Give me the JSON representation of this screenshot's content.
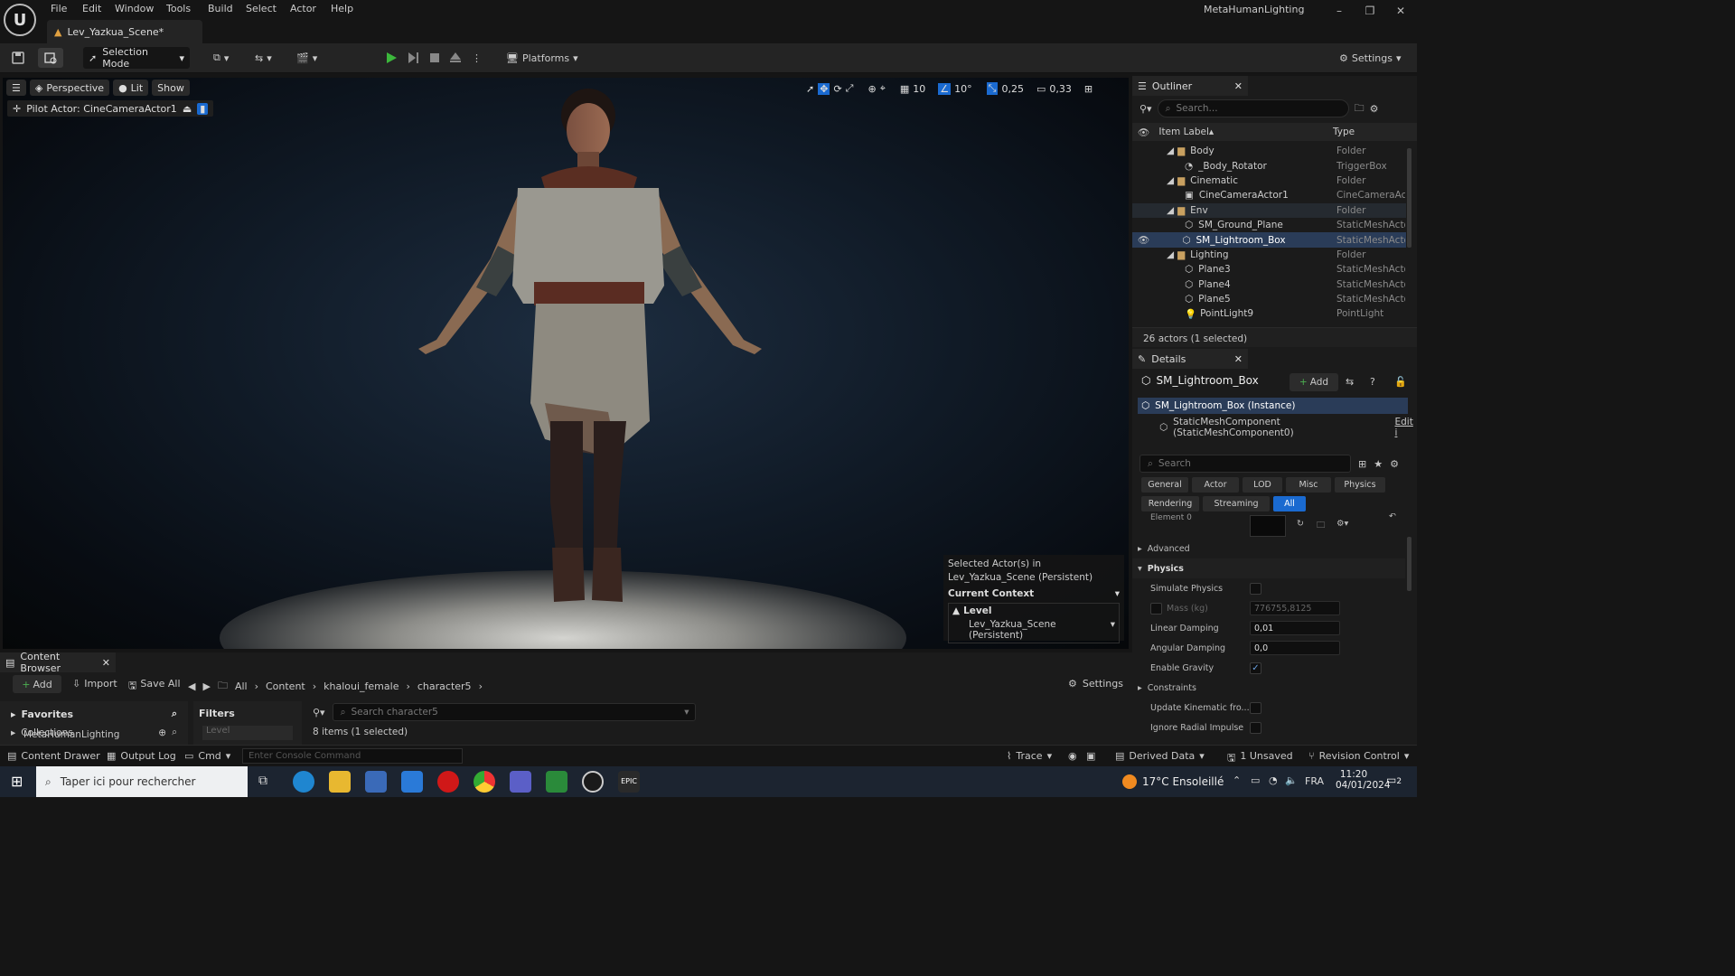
{
  "window": {
    "app_title": "MetaHumanLighting",
    "doc_tab": "Lev_Yazkua_Scene*"
  },
  "menu": [
    "File",
    "Edit",
    "Window",
    "Tools",
    "Build",
    "Select",
    "Actor",
    "Help"
  ],
  "toolbar": {
    "mode": "Selection Mode",
    "platforms": "Platforms",
    "settings": "Settings"
  },
  "viewport": {
    "perspective": "Perspective",
    "lit": "Lit",
    "show": "Show",
    "pilot": "Pilot Actor: CineCameraActor1",
    "grid": "10",
    "angle": "10°",
    "scale": "0,25",
    "camera_speed": "0,33"
  },
  "context_panel": {
    "line1": "Selected Actor(s) in",
    "line2": "Lev_Yazkua_Scene (Persistent)",
    "header": "Current Context",
    "level_label": "Level",
    "level_value": "Lev_Yazkua_Scene (Persistent)"
  },
  "outliner": {
    "title": "Outliner",
    "search_placeholder": "Search...",
    "col_label": "Item Label",
    "col_type": "Type",
    "rows": [
      {
        "label": "Body",
        "type": "Folder"
      },
      {
        "label": "_Body_Rotator",
        "type": "TriggerBox"
      },
      {
        "label": "Cinematic",
        "type": "Folder"
      },
      {
        "label": "CineCameraActor1",
        "type": "CineCameraAct"
      },
      {
        "label": "Env",
        "type": "Folder"
      },
      {
        "label": "SM_Ground_Plane",
        "type": "StaticMeshActo"
      },
      {
        "label": "SM_Lightroom_Box",
        "type": "StaticMeshActo"
      },
      {
        "label": "Lighting",
        "type": "Folder"
      },
      {
        "label": "Plane3",
        "type": "StaticMeshActo"
      },
      {
        "label": "Plane4",
        "type": "StaticMeshActo"
      },
      {
        "label": "Plane5",
        "type": "StaticMeshActo"
      },
      {
        "label": "PointLight9",
        "type": "PointLight"
      }
    ],
    "footer": "26 actors (1 selected)"
  },
  "details": {
    "title": "Details",
    "actor": "SM_Lightroom_Box",
    "add": "Add",
    "instance": "SM_Lightroom_Box (Instance)",
    "component": "StaticMeshComponent (StaticMeshComponent0)",
    "edit": "Edit i",
    "search_placeholder": "Search",
    "filters_row1": [
      "General",
      "Actor",
      "LOD",
      "Misc",
      "Physics"
    ],
    "filters_row2": [
      "Rendering",
      "Streaming",
      "All"
    ],
    "element_label": "Element 0",
    "advanced": "Advanced",
    "physics": "Physics",
    "simulate_physics": "Simulate Physics",
    "mass": "Mass (kg)",
    "mass_value": "776755,8125",
    "linear_damping": "Linear Damping",
    "linear_damping_value": "0,01",
    "angular_damping": "Angular Damping",
    "angular_damping_value": "0,0",
    "enable_gravity": "Enable Gravity",
    "constraints": "Constraints",
    "update_kinematic": "Update Kinematic fro...",
    "ignore_radial": "Ignore Radial Impulse"
  },
  "content_browser": {
    "title": "Content Browser",
    "add": "Add",
    "import": "Import",
    "save_all": "Save All",
    "crumbs": [
      "All",
      "Content",
      "khaloui_female",
      "character5"
    ],
    "settings": "Settings",
    "favorites": "Favorites",
    "collections": "Collections",
    "project": "MetaHumanLighting",
    "filters": "Filters",
    "filter_level": "Level",
    "search_placeholder": "Search character5",
    "count": "8 items (1 selected)"
  },
  "status": {
    "content_drawer": "Content Drawer",
    "output_log": "Output Log",
    "cmd": "Cmd",
    "console_placeholder": "Enter Console Command",
    "trace": "Trace",
    "derived": "Derived Data",
    "unsaved": "1 Unsaved",
    "revision": "Revision Control"
  },
  "taskbar": {
    "search": "Taper ici pour rechercher",
    "weather": "17°C Ensoleillé",
    "lang": "FRA",
    "time": "11:20",
    "date": "04/01/2024",
    "notif": "2"
  }
}
